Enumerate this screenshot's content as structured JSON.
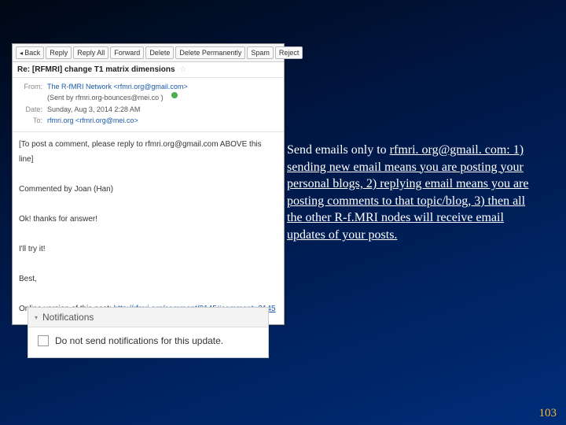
{
  "toolbar": {
    "back": "Back",
    "reply": "Reply",
    "reply_all": "Reply All",
    "forward": "Forward",
    "delete": "Delete",
    "delete_perm": "Delete Permanently",
    "spam": "Spam",
    "reject": "Reject"
  },
  "email": {
    "subject_prefix": "Re: [RFMRI] change T1 matrix dimensions",
    "from_label": "From:",
    "from_value": "The R-fMRI Network <rfmri.org@gmail.com>",
    "sent_by": "(Sent by rfmri.org-bounces@mei.co )",
    "date_label": "Date:",
    "date_value": "Sunday, Aug 3, 2014 2:28 AM",
    "to_label": "To:",
    "to_value": "rfmri.org <rfmri.org@mei.co>",
    "body_notice": "[To post a comment, please reply to rfmri.org@gmail.com ABOVE this line]",
    "body_commented": "Commented by Joan (Han)",
    "body_line1": "Ok! thanks for answer!",
    "body_line2": "I'll try it!",
    "body_signoff": "Best,",
    "body_online_prefix": "Online version of this post: ",
    "body_online_link": "http://rfmri.org/comment/3145#comment=3145"
  },
  "notif": {
    "title": "Notifications",
    "checkbox_label": "Do not send notifications for this update."
  },
  "side": {
    "lead": "Send emails only to ",
    "email": "rfmri. org@gmail. com: ",
    "rest": "1) sending new email means you are posting your personal blogs, 2) replying email means you are posting comments to that topic/blog, 3) then all the other R-f.MRI nodes will receive email updates of your posts."
  },
  "page_number": "103"
}
